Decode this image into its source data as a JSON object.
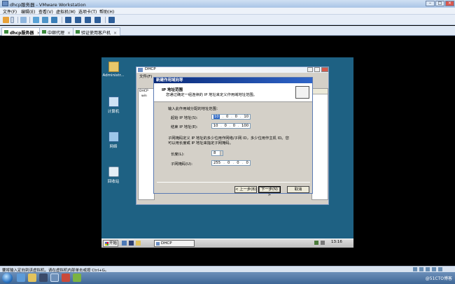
{
  "vmware": {
    "title": "dhcp服务器 - VMware Workstation",
    "menu": [
      "文件(F)",
      "编辑(E)",
      "查看(V)",
      "虚拟机(M)",
      "选项卡(T)",
      "帮助(H)"
    ],
    "tabs": [
      {
        "label": "dhcp服务器",
        "active": true
      },
      {
        "label": "中继代理",
        "active": false
      },
      {
        "label": "验证使用客户机",
        "active": false
      }
    ],
    "status_text": "要将输入定向到该虚拟机，请在虚拟机内部单击或按 Ctrl+G。"
  },
  "guest": {
    "desktop_icons": [
      {
        "label": "Administr..."
      },
      {
        "label": "计算机"
      },
      {
        "label": "网络"
      },
      {
        "label": "回收站"
      }
    ],
    "taskbar": {
      "start_label": "开始",
      "task_label": "DHCP",
      "clock": "13:16"
    },
    "dhcp_window": {
      "title": "DHCP",
      "menu_label": "文件(F)",
      "tree_items": [
        "DHCP",
        "win"
      ]
    }
  },
  "wizard": {
    "title": "新建作用域向导",
    "heading": "IP 地址范围",
    "subheading": "您通过确定一组连续的 IP 地址来定义作用域地址范围。",
    "prompt": "输入此作用域分配的地址范围：",
    "start_ip_label": "起始 IP 地址(S):",
    "start_ip": [
      "10",
      "0",
      "0",
      "10"
    ],
    "end_ip_label": "结束 IP 地址(E):",
    "end_ip": [
      "10",
      "0",
      "0",
      "100"
    ],
    "mask_note_line1": "子网掩码定义 IP 地址的多少位用作网络/子网 ID，多少位用作主机 ID。您",
    "mask_note_line2": "可以用长度或 IP 地址来指定子网掩码。",
    "length_label": "长度(L):",
    "length_value": "8",
    "mask_label": "子网掩码(U):",
    "mask_ip": [
      "255",
      "0",
      "0",
      "0"
    ],
    "back_button": "< 上一步(B)",
    "next_button": "下一步(N) >",
    "cancel_button": "取消"
  },
  "host_taskbar": {
    "watermark": "@51CTO博客"
  },
  "colors": {
    "guest_desktop": "#1e6183",
    "wizard_title_bar": "#0a2a78",
    "vmware_chrome": "#dfe8f4"
  }
}
